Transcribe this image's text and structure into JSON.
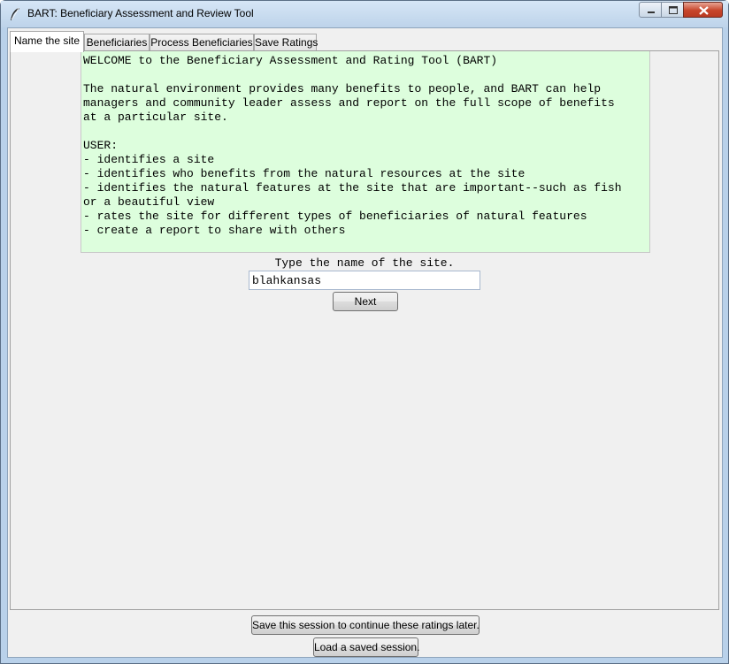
{
  "window": {
    "title": "BART: Beneficiary Assessment and Review Tool"
  },
  "tabs": [
    {
      "label": "Name the site"
    },
    {
      "label": "Beneficiaries"
    },
    {
      "label": "Process Beneficiaries"
    },
    {
      "label": "Save Ratings"
    }
  ],
  "welcome": {
    "lines": [
      "WELCOME to the Beneficiary Assessment and Rating Tool (BART)",
      "",
      "The natural environment provides many benefits to people, and BART can help",
      "managers and community leader assess and report on the full scope of benefits",
      "at a particular site.",
      "",
      "USER:",
      "- identifies a site",
      "- identifies who benefits from the natural resources at the site",
      "- identifies the natural features at the site that are important--such as fish",
      "or a beautiful view",
      "- rates the site for different types of beneficiaries of natural features",
      "- create a report to share with others"
    ]
  },
  "site_form": {
    "prompt": "Type the name of the site.",
    "value": "blahkansas",
    "next_label": "Next"
  },
  "footer": {
    "save_label": "Save this session to continue these ratings later.",
    "load_label": "Load a saved session."
  },
  "colors": {
    "welcome_bg": "#ddfedd",
    "client_bg": "#f0f0f0",
    "frame": "#b9d1ea"
  }
}
